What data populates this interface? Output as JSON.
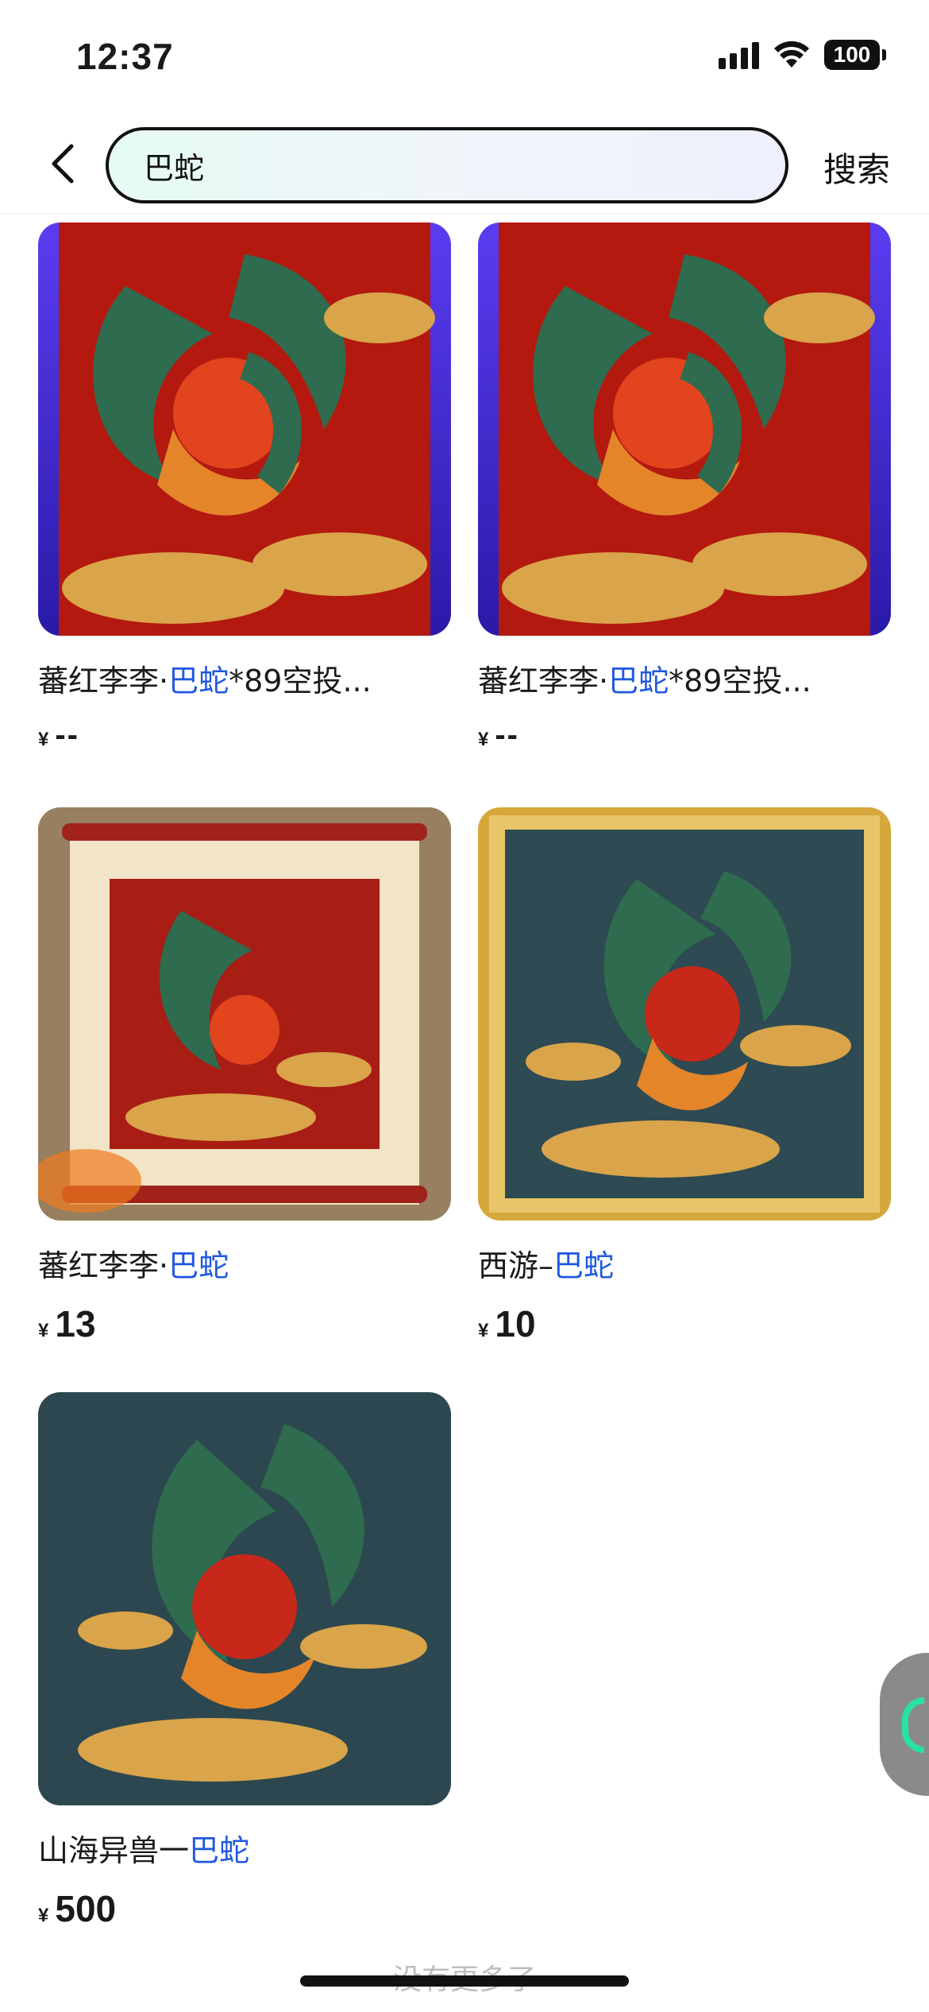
{
  "status_bar": {
    "time": "12:37",
    "battery": "100"
  },
  "search": {
    "query": "巴蛇",
    "button_label": "搜索"
  },
  "products": [
    {
      "title_prefix": "蕃红李李·",
      "title_keyword": "巴蛇",
      "title_suffix": "*89空投...",
      "price_symbol": "¥",
      "price": "--"
    },
    {
      "title_prefix": "蕃红李李·",
      "title_keyword": "巴蛇",
      "title_suffix": "*89空投...",
      "price_symbol": "¥",
      "price": "--"
    },
    {
      "title_prefix": "蕃红李李·",
      "title_keyword": "巴蛇",
      "title_suffix": "",
      "price_symbol": "¥",
      "price": "13"
    },
    {
      "title_prefix": "西游–",
      "title_keyword": "巴蛇",
      "title_suffix": "",
      "price_symbol": "¥",
      "price": "10"
    },
    {
      "title_prefix": "山海异兽一",
      "title_keyword": "巴蛇",
      "title_suffix": "",
      "price_symbol": "¥",
      "price": "500"
    }
  ],
  "footer": {
    "text": "没有更多了"
  },
  "colors": {
    "keyword": "#1f57e0",
    "accent_green": "#27e3a0"
  }
}
